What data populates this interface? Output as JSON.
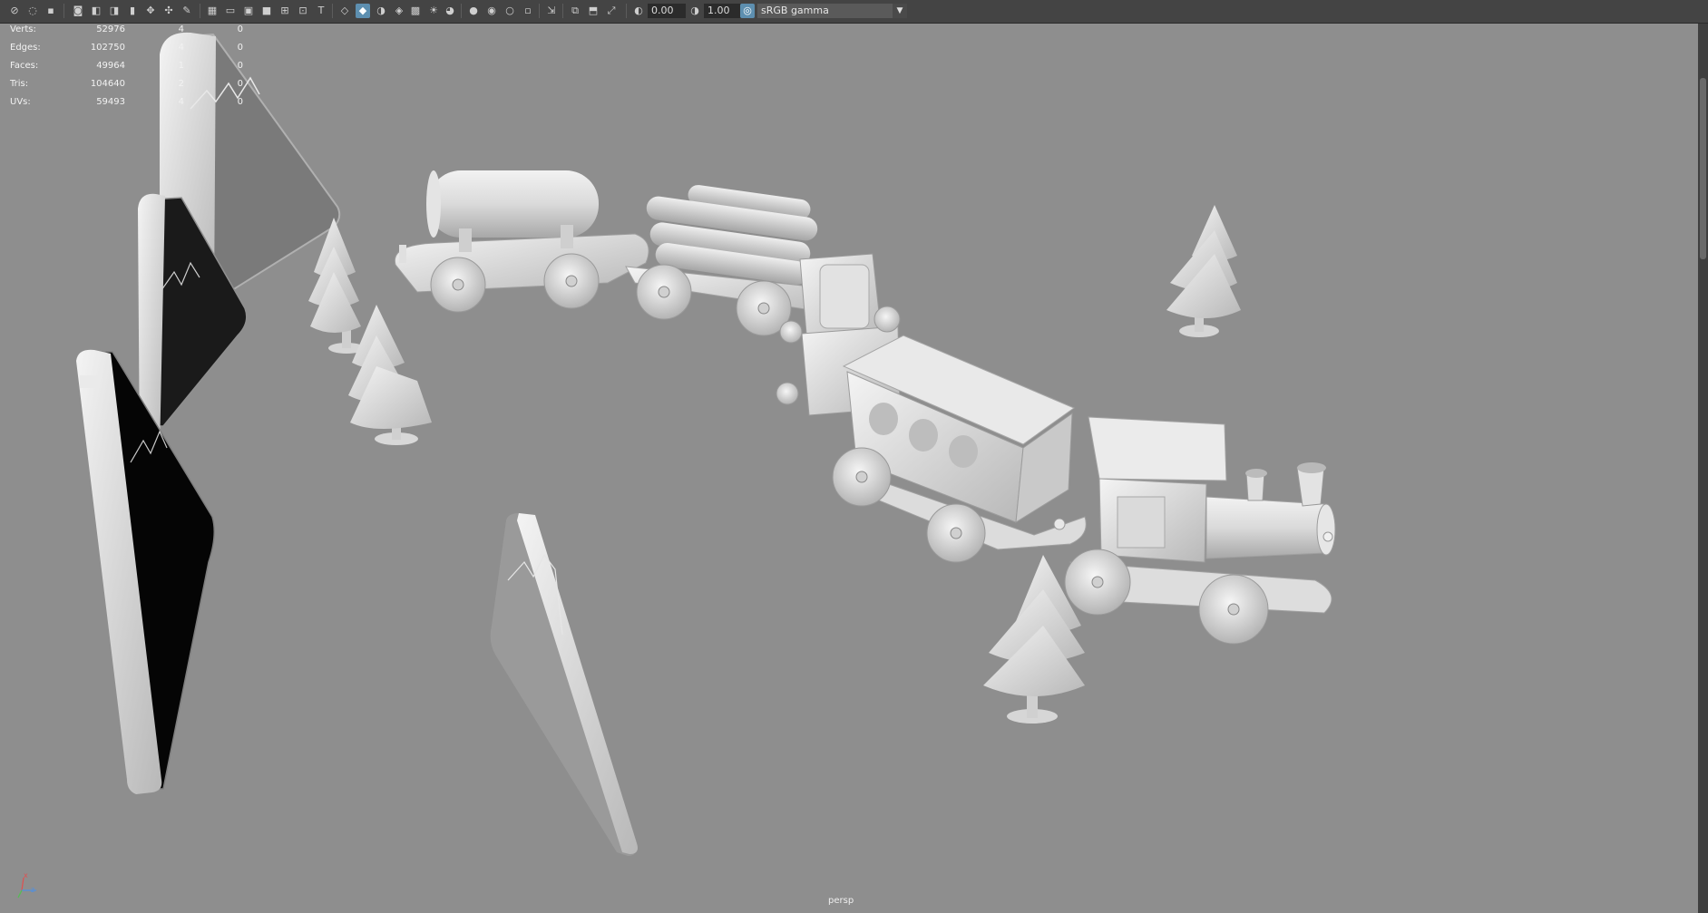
{
  "toolbar": {
    "exposure_value": "0.00",
    "gamma_value": "1.00",
    "color_space": "sRGB gamma",
    "icons": [
      "select-icon",
      "lasso-icon",
      "paint-icon",
      "camera-icon",
      "bookmark-icon",
      "grid-icon",
      "film-gate-icon",
      "resolution-gate-icon",
      "wireframe-icon",
      "smooth-shade-icon",
      "textured-icon",
      "lighting-icon",
      "shadows-icon",
      "ambient-occlusion-icon",
      "isolate-icon",
      "xray-icon",
      "exposure-icon",
      "gamma-icon",
      "color-management-icon"
    ]
  },
  "hud": {
    "rows": [
      {
        "label": "Verts:",
        "total": "52976",
        "selected": "4",
        "other": "0"
      },
      {
        "label": "Edges:",
        "total": "102750",
        "selected": "4",
        "other": "0"
      },
      {
        "label": "Faces:",
        "total": "49964",
        "selected": "1",
        "other": "0"
      },
      {
        "label": "Tris:",
        "total": "104640",
        "selected": "2",
        "other": "0"
      },
      {
        "label": "UVs:",
        "total": "59493",
        "selected": "4",
        "other": "0"
      }
    ]
  },
  "viewport": {
    "camera": "persp",
    "background": "#8e8e8e",
    "axis_labels": {
      "x": "x",
      "y": "y",
      "z": "z"
    }
  }
}
